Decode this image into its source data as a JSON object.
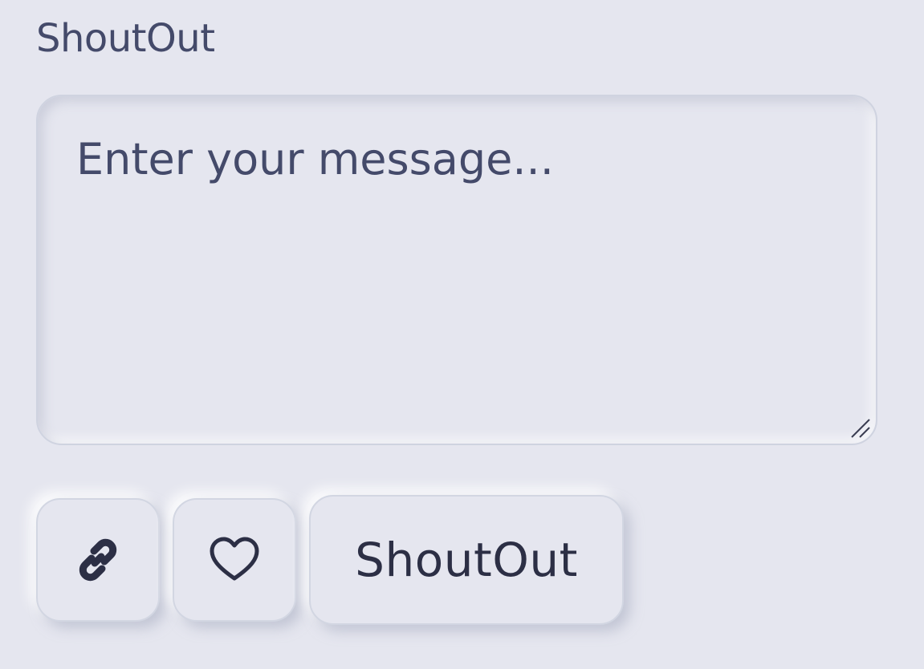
{
  "widget": {
    "title": "ShoutOut"
  },
  "message": {
    "value": "",
    "placeholder": "Enter your message..."
  },
  "actions": {
    "link_icon": "link-icon",
    "heart_icon": "heart-icon",
    "submit_label": "ShoutOut"
  },
  "colors": {
    "background": "#e5e6ef",
    "text": "#444a6a",
    "icon": "#2c2f45"
  }
}
